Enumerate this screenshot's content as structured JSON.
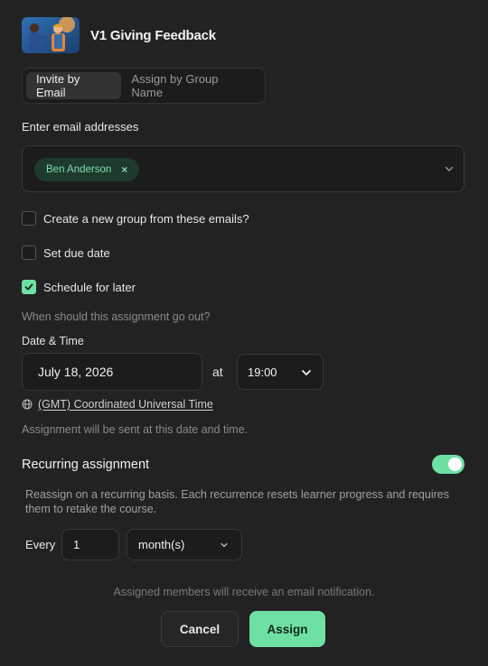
{
  "header": {
    "title": "V1 Giving Feedback",
    "thumbnail_alt": "two workers illustration"
  },
  "tabs": [
    {
      "label": "Invite by Email",
      "active": true
    },
    {
      "label": "Assign by Group Name",
      "active": false
    }
  ],
  "email": {
    "label": "Enter email addresses",
    "chips": [
      {
        "label": "Ben Anderson",
        "remove": "×"
      }
    ]
  },
  "options": {
    "create_group": {
      "label": "Create a new group from these emails?",
      "checked": false
    },
    "due_date": {
      "label": "Set due date",
      "checked": false
    },
    "schedule": {
      "label": "Schedule for later",
      "checked": true
    }
  },
  "schedule": {
    "question": "When should this assignment go out?",
    "datetime_label": "Date & Time",
    "date": "July 18, 2026",
    "at": "at",
    "time": "19:00",
    "timezone": "(GMT) Coordinated Universal Time",
    "hint": "Assignment will be sent at this date and time."
  },
  "recurring": {
    "label": "Recurring assignment",
    "enabled": true,
    "description": "Reassign on a recurring basis. Each recurrence resets learner progress and requires them to retake the course.",
    "every_label": "Every",
    "every_value": "1",
    "unit": "month(s)"
  },
  "footer": {
    "notice": "Assigned members will receive an email notification.",
    "cancel_label": "Cancel",
    "assign_label": "Assign"
  },
  "colors": {
    "accent": "#6ee0a4",
    "background": "#222222",
    "chip_bg": "#1e3a2c"
  }
}
